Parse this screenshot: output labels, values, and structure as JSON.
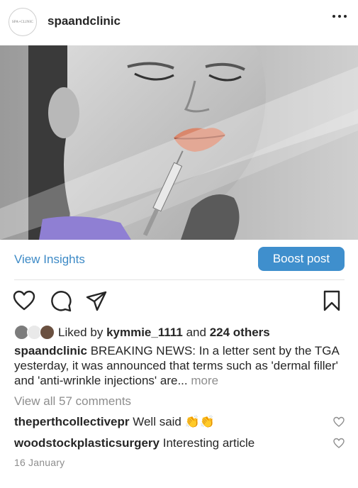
{
  "post": {
    "account": {
      "username": "spaandclinic",
      "avatar_text": "SPA+CLINIC"
    },
    "menu_icon": "more-horizontal-icon"
  },
  "insights": {
    "view_label": "View Insights",
    "boost_label": "Boost post"
  },
  "actions": {
    "icons": [
      "heart-icon",
      "comment-icon",
      "share-icon",
      "bookmark-icon"
    ]
  },
  "likes": {
    "prefix": "Liked by",
    "user": "kymmie_1111",
    "connector": "and",
    "others": "224 others"
  },
  "caption": {
    "username": "spaandclinic",
    "text": "BREAKING NEWS: In a letter sent by the TGA yesterday, it was announced that terms such as 'dermal filler' and 'anti-wrinkle injections' are...",
    "more": "more"
  },
  "view_comments": "View all 57 comments",
  "comments": [
    {
      "username": "theperthcollectivepr",
      "text": "Well said",
      "emoji": "👏👏"
    },
    {
      "username": "woodstockplasticsurgery",
      "text": "Interesting article",
      "emoji": ""
    }
  ],
  "date": "16 January",
  "colors": {
    "accent": "#3f8fcd",
    "link": "#3d8ac6",
    "muted": "#8e8e8e",
    "text": "#262626"
  }
}
